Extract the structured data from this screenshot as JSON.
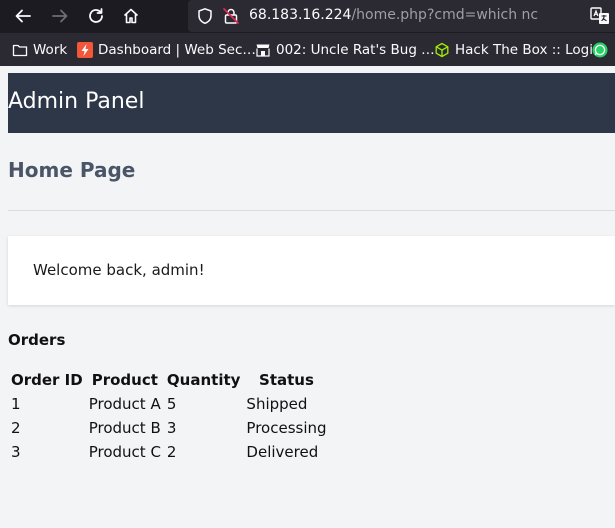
{
  "browser": {
    "url_host": "68.183.16.224",
    "url_path": "/home.php?cmd=which nc",
    "bookmarks": [
      {
        "label": "Work",
        "icon": "folder-icon"
      },
      {
        "label": "Dashboard | Web Sec…",
        "icon": "lightning-icon"
      },
      {
        "label": "002: Uncle Rat's Bug …",
        "icon": "storefront-icon"
      },
      {
        "label": "Hack The Box :: Login",
        "icon": "cube-icon"
      },
      {
        "label": "",
        "icon": "whatsapp-icon"
      }
    ]
  },
  "header": {
    "title": "Admin Panel"
  },
  "main": {
    "page_title": "Home Page",
    "welcome": "Welcome back, admin!",
    "orders_title": "Orders",
    "columns": [
      "Order ID",
      "Product",
      "Quantity",
      "Status"
    ],
    "rows": [
      [
        "1",
        "Product A",
        "5",
        "Shipped"
      ],
      [
        "2",
        "Product B",
        "3",
        "Processing"
      ],
      [
        "3",
        "Product C",
        "2",
        "Delivered"
      ]
    ]
  },
  "colors": {
    "header_bg": "#2d3748",
    "page_title": "#4a5568",
    "page_bg": "#f3f4f6",
    "toolbar_bg": "#1c1b22",
    "bookmarks_bg": "#2b2a33"
  }
}
